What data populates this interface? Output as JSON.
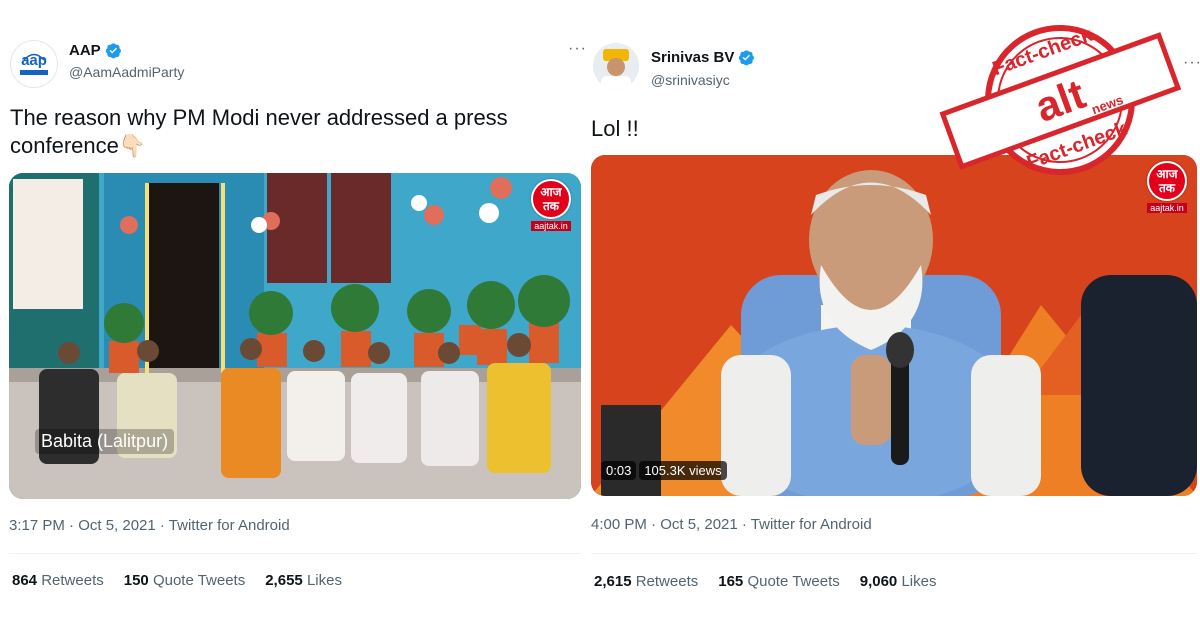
{
  "tweet_left": {
    "display_name": "AAP",
    "handle": "@AamAadmiParty",
    "avatar_caption": "aap",
    "text": "The reason why PM Modi never addressed a press conference",
    "emoji": "👇🏻",
    "caption": "Babita (Lalitpur)",
    "logo_text": "आज तक",
    "logo_url": "aajtak.in",
    "time": "3:17 PM · Oct 5, 2021 · Twitter for Android",
    "stats": {
      "retweets_n": "864",
      "retweets_l": "Retweets",
      "quotes_n": "150",
      "quotes_l": "Quote Tweets",
      "likes_n": "2,655",
      "likes_l": "Likes"
    }
  },
  "tweet_right": {
    "display_name": "Srinivas BV",
    "handle": "@srinivasiyc",
    "text": "Lol !!",
    "logo_text": "आज तक",
    "logo_url": "aajtak.in",
    "video_time": "0:03",
    "video_views": "105.3K views",
    "time": "4:00 PM · Oct 5, 2021 · Twitter for Android",
    "stats": {
      "retweets_n": "2,615",
      "retweets_l": "Retweets",
      "quotes_n": "165",
      "quotes_l": "Quote Tweets",
      "likes_n": "9,060",
      "likes_l": "Likes"
    }
  },
  "stamp": {
    "top": "Fact-check",
    "center": "alt",
    "sub": "news",
    "bottom": "Fact-check",
    "color": "#d9252c"
  },
  "more_icon": "···",
  "colors": {
    "verified": "#1d9bf0",
    "aap_blue": "#1565c0",
    "aajtak_red": "#e3001b"
  }
}
